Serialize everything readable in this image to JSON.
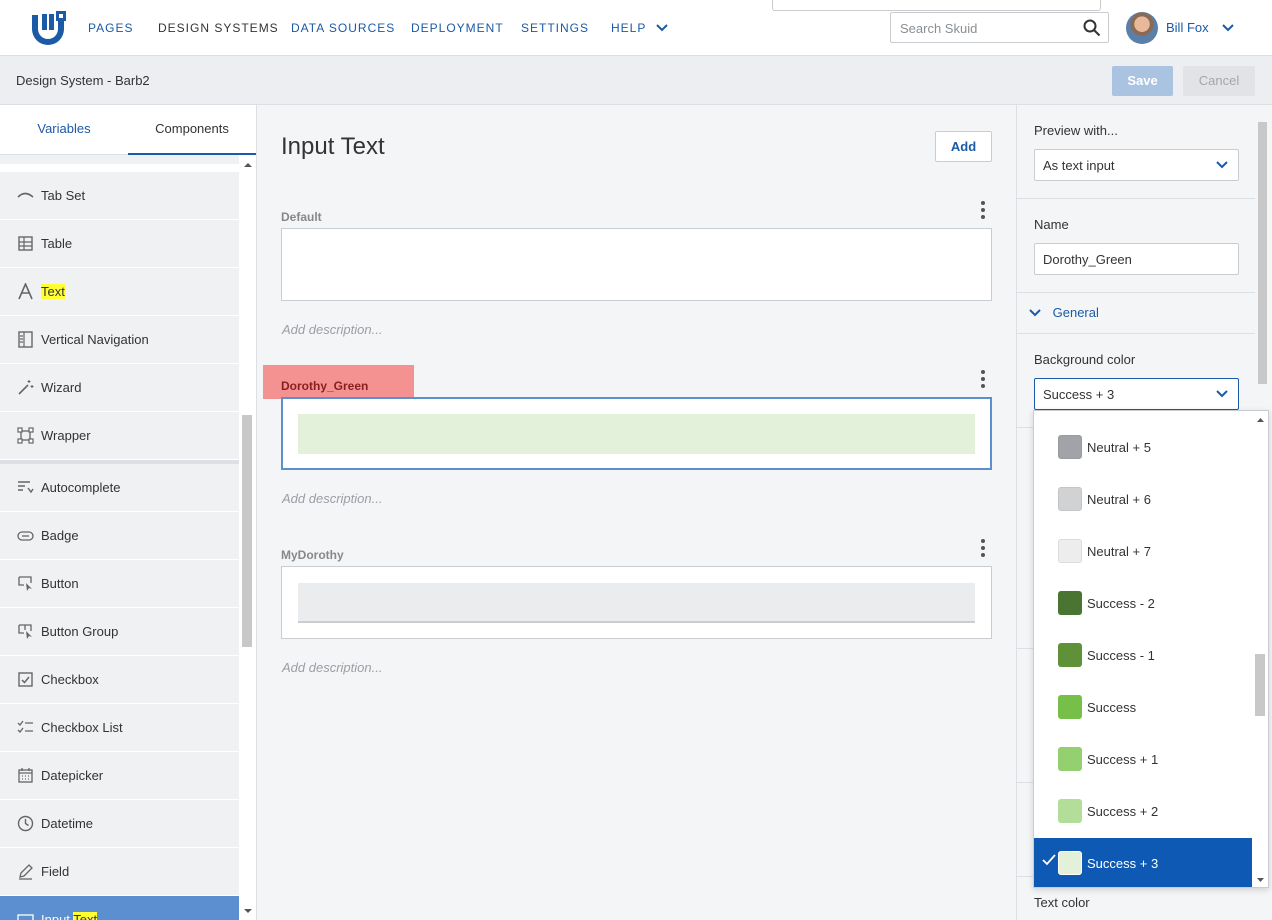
{
  "header": {
    "nav": [
      "PAGES",
      "DESIGN SYSTEMS",
      "DATA SOURCES",
      "DEPLOYMENT",
      "SETTINGS",
      "HELP"
    ],
    "search_placeholder": "Search Skuid",
    "user_name": "Bill Fox"
  },
  "subheader": {
    "title": "Design System - Barb2",
    "save_label": "Save",
    "cancel_label": "Cancel"
  },
  "left_panel": {
    "tabs": [
      "Variables",
      "Components"
    ],
    "active_tab": "Components",
    "items_top": [
      {
        "label": "Tab Set",
        "icon": "tab-set-icon"
      },
      {
        "label": "Table",
        "icon": "table-icon"
      },
      {
        "label": "Text",
        "icon": "text-icon",
        "highlight": true
      },
      {
        "label": "Vertical Navigation",
        "icon": "vertical-navigation-icon"
      },
      {
        "label": "Wizard",
        "icon": "wizard-icon"
      },
      {
        "label": "Wrapper",
        "icon": "wrapper-icon"
      }
    ],
    "items_bottom": [
      {
        "label": "Autocomplete",
        "icon": "autocomplete-icon"
      },
      {
        "label": "Badge",
        "icon": "badge-icon"
      },
      {
        "label": "Button",
        "icon": "button-icon"
      },
      {
        "label": "Button Group",
        "icon": "button-group-icon"
      },
      {
        "label": "Checkbox",
        "icon": "checkbox-icon"
      },
      {
        "label": "Checkbox List",
        "icon": "checkbox-list-icon"
      },
      {
        "label": "Datepicker",
        "icon": "datepicker-icon"
      },
      {
        "label": "Datetime",
        "icon": "datetime-icon"
      },
      {
        "label": "Field",
        "icon": "field-icon"
      },
      {
        "label_prefix": "Input ",
        "label_hl": "Text",
        "icon": "input-text-icon",
        "selected": true
      }
    ]
  },
  "main": {
    "title": "Input Text",
    "add_label": "Add",
    "variants": [
      {
        "label": "Default",
        "description": "Add description..."
      },
      {
        "label": "Dorothy_Green",
        "description": "Add description..."
      },
      {
        "label": "MyDorothy",
        "description": "Add description..."
      }
    ]
  },
  "right_panel": {
    "preview_label": "Preview with...",
    "preview_value": "As text input",
    "name_label": "Name",
    "name_value": "Dorothy_Green",
    "general_label": "General",
    "bg_label": "Background color",
    "bg_value": "Success + 3",
    "text_color_label": "Text color"
  },
  "dropdown": {
    "options": [
      {
        "label": "Neutral + 5",
        "color": "#a2a3a8"
      },
      {
        "label": "Neutral + 6",
        "color": "#d1d2d4"
      },
      {
        "label": "Neutral + 7",
        "color": "#ededee"
      },
      {
        "label": "Success - 2",
        "color": "#4a7431"
      },
      {
        "label": "Success - 1",
        "color": "#5f9238"
      },
      {
        "label": "Success",
        "color": "#76c04a"
      },
      {
        "label": "Success + 1",
        "color": "#94cf70"
      },
      {
        "label": "Success + 2",
        "color": "#b3de99"
      },
      {
        "label": "Success + 3",
        "color": "#e3f1da",
        "selected": true
      }
    ]
  },
  "colors": {
    "accent": "#1a5aa6",
    "selected_option": "#0d59b4",
    "label_highlight": "#f49291",
    "preview_fill": "#e3f1da"
  }
}
